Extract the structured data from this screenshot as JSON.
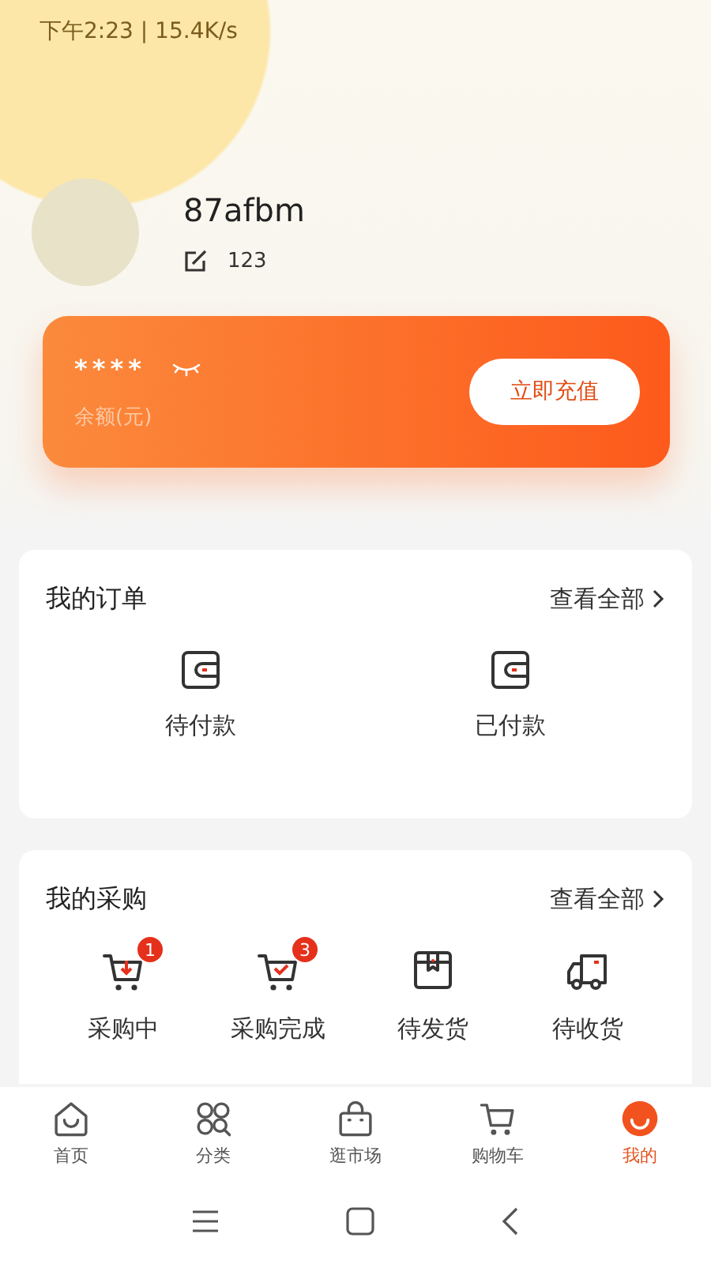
{
  "status_bar": {
    "time": "下午2:23 | 15.4K/s"
  },
  "profile": {
    "username": "87afbm",
    "signature": "123"
  },
  "balance": {
    "amount": "****",
    "hidden": true,
    "label": "余额(元)",
    "button": "立即充值"
  },
  "orders": {
    "title": "我的订单",
    "link": "查看全部",
    "items": [
      {
        "label": "待付款",
        "kind": "wallet"
      },
      {
        "label": "已付款",
        "kind": "wallet"
      }
    ]
  },
  "purchases": {
    "title": "我的采购",
    "link": "查看全部",
    "items": [
      {
        "label": "采购中",
        "kind": "cart-down",
        "badge": "1"
      },
      {
        "label": "采购完成",
        "kind": "cart-check",
        "badge": "3"
      },
      {
        "label": "待发货",
        "kind": "box"
      },
      {
        "label": "待收货",
        "kind": "truck"
      }
    ]
  },
  "tab_bar": [
    {
      "label": "首页",
      "kind": "home",
      "selected": false
    },
    {
      "label": "分类",
      "kind": "grid",
      "selected": false
    },
    {
      "label": "逛市场",
      "kind": "bag",
      "selected": false
    },
    {
      "label": "购物车",
      "kind": "cart",
      "selected": false
    },
    {
      "label": "我的",
      "kind": "face",
      "selected": true
    }
  ]
}
